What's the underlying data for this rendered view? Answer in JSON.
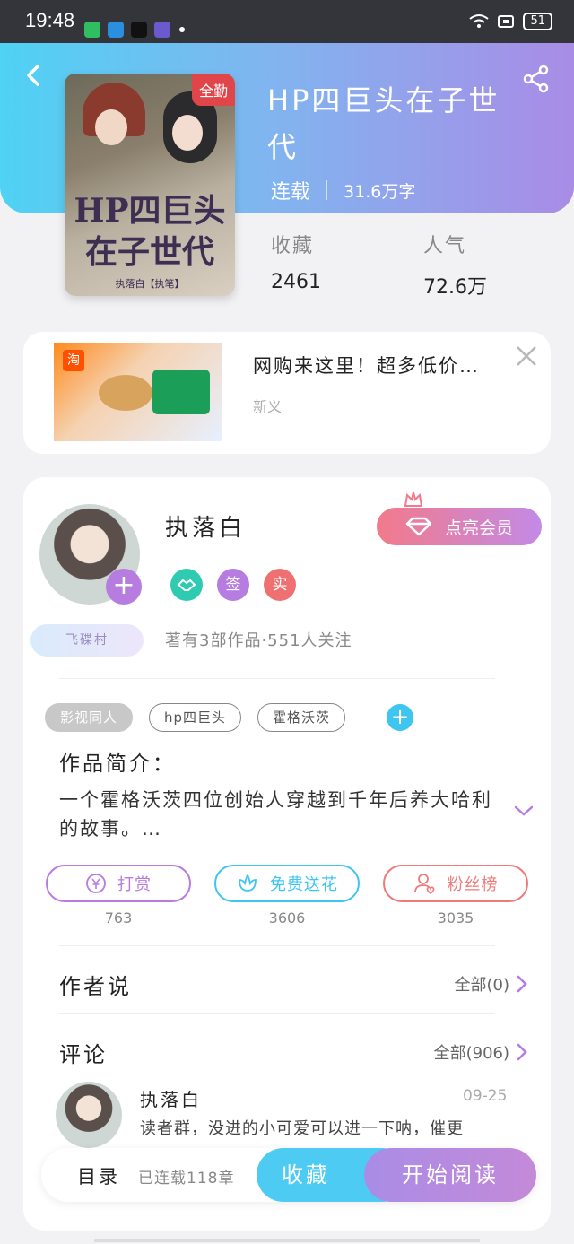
{
  "status_bar": {
    "time": "19:48",
    "battery": "51"
  },
  "book": {
    "title": "HP四巨头在子世代",
    "status": "连载",
    "word_count": "31.6万字",
    "cover_badge": "全勤",
    "cover_title": "HP四巨头在子世代",
    "cover_author": "执落白【执笔】"
  },
  "stats": {
    "favorites_label": "收藏",
    "favorites_value": "2461",
    "popularity_label": "人气",
    "popularity_value": "72.6万"
  },
  "ad": {
    "title": "网购来这里！超多低价…",
    "source": "新义",
    "image_logo": "淘"
  },
  "author": {
    "name": "执落白",
    "vip_label": "点亮会员",
    "village": "飞碟村",
    "badge_sign": "签",
    "badge_real": "实",
    "works_info": "著有3部作品·551人关注"
  },
  "tags": [
    "影视同人",
    "hp四巨头",
    "霍格沃茨"
  ],
  "intro": {
    "title": "作品简介：",
    "text": "一个霍格沃茨四位创始人穿越到千年后养大哈利的故事。…"
  },
  "actions": [
    {
      "label": "打赏",
      "count": "763",
      "color": "#b77ce0",
      "icon": "yen-icon"
    },
    {
      "label": "免费送花",
      "count": "3606",
      "color": "#3ec6f0",
      "icon": "flower-icon"
    },
    {
      "label": "粉丝榜",
      "count": "3035",
      "color": "#ee7a7a",
      "icon": "fan-icon"
    }
  ],
  "author_says": {
    "title": "作者说",
    "more": "全部(0)"
  },
  "comments": {
    "title": "评论",
    "more": "全部(906)",
    "items": [
      {
        "name": "执落白",
        "date": "09-25",
        "text": "读者群，没进的小可爱可以进一下呐，催更"
      }
    ]
  },
  "bottom_bar": {
    "toc": "目录",
    "serial": "已连载118章",
    "collect": "收藏",
    "read": "开始阅读"
  },
  "colors": {
    "accent_blue": "#4ecbf2",
    "accent_purple": "#a98ce6",
    "vip_pink": "#f27a8a"
  }
}
